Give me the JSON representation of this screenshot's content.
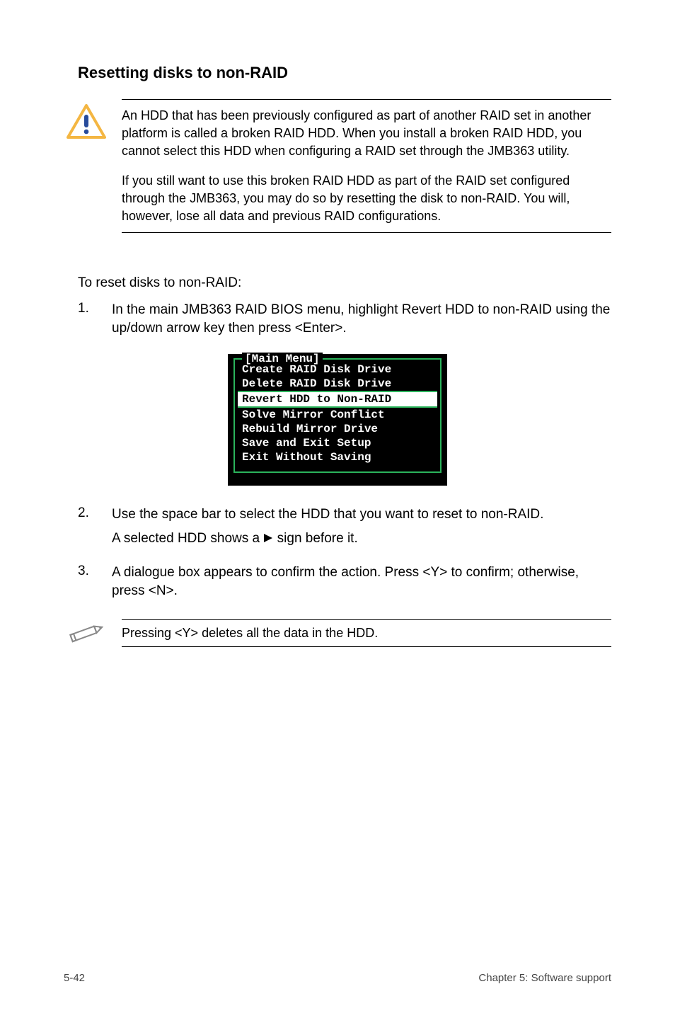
{
  "heading1": "Resetting disks to non-RAID",
  "callout": {
    "p1": "An HDD that has been previously configured as part of another RAID set in another platform is called a broken RAID HDD. When you install a broken RAID HDD, you cannot select this HDD when configuring a RAID set through the JMB363 utility.",
    "p2": "If you still want to use this broken RAID HDD as part of the RAID set configured through the JMB363, you may do so by resetting the disk to non-RAID. You will, however, lose all data and previous RAID configurations."
  },
  "introText": "To reset disks to non-RAID:",
  "steps": {
    "s1": {
      "num": "1.",
      "text": "In the main JMB363 RAID BIOS menu, highlight Revert HDD to non-RAID using the up/down arrow key then press <Enter>."
    },
    "s2": {
      "num": "2.",
      "textA": "Use the space bar to select the HDD that you want to reset to non-RAID.",
      "textB_prefix": "A selected HDD shows a ",
      "textB_suffix": " sign before it."
    },
    "s3": {
      "num": "3.",
      "text": "A dialogue box appears to confirm the action. Press <Y> to confirm; otherwise, press <N>."
    }
  },
  "biosMenu": {
    "title": "[Main Menu]",
    "items": [
      {
        "label": "Create RAID Disk Drive",
        "selected": false
      },
      {
        "label": "Delete RAID Disk Drive",
        "selected": false
      },
      {
        "label": "Revert HDD to Non-RAID",
        "selected": true
      },
      {
        "label": "Solve Mirror Conflict",
        "selected": false
      },
      {
        "label": "Rebuild Mirror Drive",
        "selected": false
      },
      {
        "label": "Save and Exit Setup",
        "selected": false
      },
      {
        "label": "Exit Without Saving",
        "selected": false
      }
    ]
  },
  "noteText": "Pressing <Y> deletes all the data in the HDD.",
  "footer": {
    "left": "5-42",
    "right": "Chapter 5: Software support"
  }
}
